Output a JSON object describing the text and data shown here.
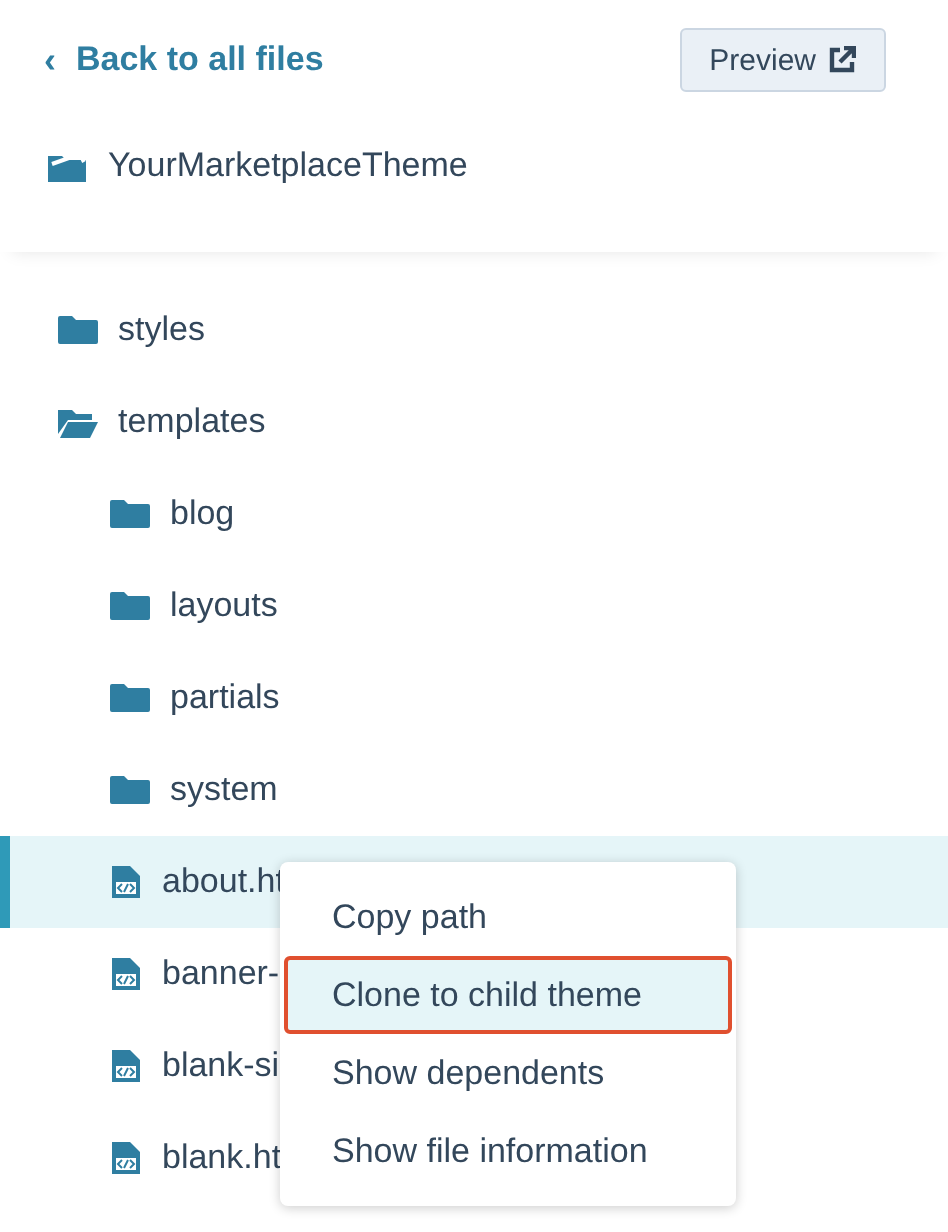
{
  "back_link": {
    "icon": "‹",
    "label": "Back to all files"
  },
  "preview_button": {
    "label": "Preview"
  },
  "theme": {
    "name": "YourMarketplaceTheme"
  },
  "tree": [
    {
      "kind": "folder",
      "name": "styles",
      "expanded": false,
      "selected": false
    },
    {
      "kind": "folder",
      "name": "templates",
      "expanded": true,
      "selected": false,
      "children": [
        {
          "kind": "folder",
          "name": "blog",
          "expanded": false,
          "selected": false
        },
        {
          "kind": "folder",
          "name": "layouts",
          "expanded": false,
          "selected": false
        },
        {
          "kind": "folder",
          "name": "partials",
          "expanded": false,
          "selected": false
        },
        {
          "kind": "folder",
          "name": "system",
          "expanded": false,
          "selected": false
        },
        {
          "kind": "file",
          "name": "about.ht",
          "selected": true
        },
        {
          "kind": "file",
          "name": "banner-",
          "selected": false
        },
        {
          "kind": "file",
          "name": "blank-si",
          "selected": false
        },
        {
          "kind": "file",
          "name": "blank.ht",
          "selected": false
        }
      ]
    }
  ],
  "context_menu": [
    {
      "label": "Copy path",
      "highlighted": false
    },
    {
      "label": "Clone to child theme",
      "highlighted": true
    },
    {
      "label": "Show dependents",
      "highlighted": false
    },
    {
      "label": "Show file information",
      "highlighted": false
    }
  ]
}
